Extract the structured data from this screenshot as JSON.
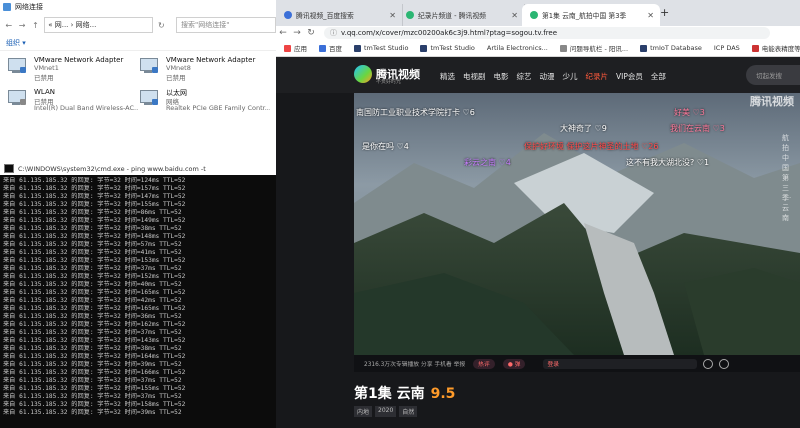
{
  "net_window": {
    "title": "网络连接",
    "path": "« 网... › 网络...",
    "search_placeholder": "搜索\"网络连接\"",
    "organize": "组织 ▾",
    "adapters": [
      {
        "name": "VMware Network Adapter",
        "line2": "VMnet1",
        "line3": "已禁用"
      },
      {
        "name": "VMware Network Adapter",
        "line2": "VMnet8",
        "line3": "已禁用"
      },
      {
        "name": "WLAN",
        "line2": "已禁用",
        "line3": "Intel(R) Dual Band Wireless-AC..."
      },
      {
        "name": "以太网",
        "line2": "网络",
        "line3": "Realtek PCIe GBE Family Contr..."
      }
    ]
  },
  "cmd_window": {
    "title": "C:\\WINDOWS\\system32\\cmd.exe - ping  www.baidu.com  -t",
    "lines": [
      "来自 61.135.185.32 的回复: 字节=32 时间=124ms TTL=52",
      "来自 61.135.185.32 的回复: 字节=32 时间=157ms TTL=52",
      "来自 61.135.185.32 的回复: 字节=32 时间=147ms TTL=52",
      "来自 61.135.185.32 的回复: 字节=32 时间=155ms TTL=52",
      "来自 61.135.185.32 的回复: 字节=32 时间=86ms TTL=52",
      "来自 61.135.185.32 的回复: 字节=32 时间=149ms TTL=52",
      "来自 61.135.185.32 的回复: 字节=32 时间=38ms TTL=52",
      "来自 61.135.185.32 的回复: 字节=32 时间=148ms TTL=52",
      "来自 61.135.185.32 的回复: 字节=32 时间=57ms TTL=52",
      "来自 61.135.185.32 的回复: 字节=32 时间=41ms TTL=52",
      "来自 61.135.185.32 的回复: 字节=32 时间=153ms TTL=52",
      "来自 61.135.185.32 的回复: 字节=32 时间=37ms TTL=52",
      "来自 61.135.185.32 的回复: 字节=32 时间=152ms TTL=52",
      "来自 61.135.185.32 的回复: 字节=32 时间=40ms TTL=52",
      "来自 61.135.185.32 的回复: 字节=32 时间=165ms TTL=52",
      "来自 61.135.185.32 的回复: 字节=32 时间=42ms TTL=52",
      "来自 61.135.185.32 的回复: 字节=32 时间=165ms TTL=52",
      "来自 61.135.185.32 的回复: 字节=32 时间=36ms TTL=52",
      "来自 61.135.185.32 的回复: 字节=32 时间=162ms TTL=52",
      "来自 61.135.185.32 的回复: 字节=32 时间=37ms TTL=52",
      "来自 61.135.185.32 的回复: 字节=32 时间=143ms TTL=52",
      "来自 61.135.185.32 的回复: 字节=32 时间=38ms TTL=52",
      "来自 61.135.185.32 的回复: 字节=32 时间=164ms TTL=52",
      "来自 61.135.185.32 的回复: 字节=32 时间=39ms TTL=52",
      "来自 61.135.185.32 的回复: 字节=32 时间=166ms TTL=52",
      "来自 61.135.185.32 的回复: 字节=32 时间=37ms TTL=52",
      "来自 61.135.185.32 的回复: 字节=32 时间=155ms TTL=52",
      "来自 61.135.185.32 的回复: 字节=32 时间=37ms TTL=52",
      "来自 61.135.185.32 的回复: 字节=32 时间=158ms TTL=52",
      "来自 61.135.185.32 的回复: 字节=32 时间=39ms TTL=52"
    ]
  },
  "browser": {
    "tabs": [
      {
        "label": "腾讯视频_百度搜索",
        "color": "#3b6fd8"
      },
      {
        "label": "纪录片频道 - 腾讯视频",
        "color": "#2bb673"
      },
      {
        "label": "第1集 云南_航拍中国 第3季",
        "color": "#2bb673"
      }
    ],
    "new_tab": "+",
    "url": "v.qq.com/x/cover/mzc00200ak6c3j9.html?ptag=sogou.tv.free",
    "bookmarks": [
      "应用",
      "百度",
      "tmTest Studio",
      "tmTest Studio",
      "Artila Electronics...",
      "问题导航栏 - 阳讯...",
      "tmIoT Database",
      "ICP DAS",
      "电能表精度等"
    ],
    "site": {
      "logo": "腾讯视频",
      "logo_sub": "不负好时光",
      "nav": [
        "精选",
        "电视剧",
        "电影",
        "综艺",
        "动漫",
        "少儿",
        "纪录片",
        "VIP会员",
        "全部"
      ],
      "nav_active": "纪录片",
      "search_placeholder": "切起发搜"
    },
    "video": {
      "watermark": "腾讯视频",
      "vertical": "航拍中国第三季·云南",
      "danmu": [
        {
          "text": "南国防工业职业技术学院打卡",
          "likes": "6",
          "style": "white"
        },
        {
          "text": "大神奇了",
          "likes": "9",
          "style": "white"
        },
        {
          "text": "好美",
          "likes": "3",
          "style": "pink"
        },
        {
          "text": "我们在云南",
          "likes": "3",
          "style": "pink"
        },
        {
          "text": "是你在吗",
          "likes": "4",
          "style": "white"
        },
        {
          "text": "保护好环境 保护这片神圣的土地",
          "likes": "26",
          "style": "red"
        },
        {
          "text": "彩云之南",
          "likes": "4",
          "style": "purple"
        },
        {
          "text": "这不有我大湖北没?",
          "likes": "1",
          "style": "white"
        }
      ]
    },
    "controls": {
      "stats": "2316.3万次专辑播放  分享  手机看  举报",
      "hot": "热评",
      "like": "● 弹",
      "login": "登录",
      "send": "发"
    },
    "episode_title": "第1集 云南",
    "score": "9.5",
    "tags": [
      "内地",
      "2020",
      "自然"
    ]
  }
}
